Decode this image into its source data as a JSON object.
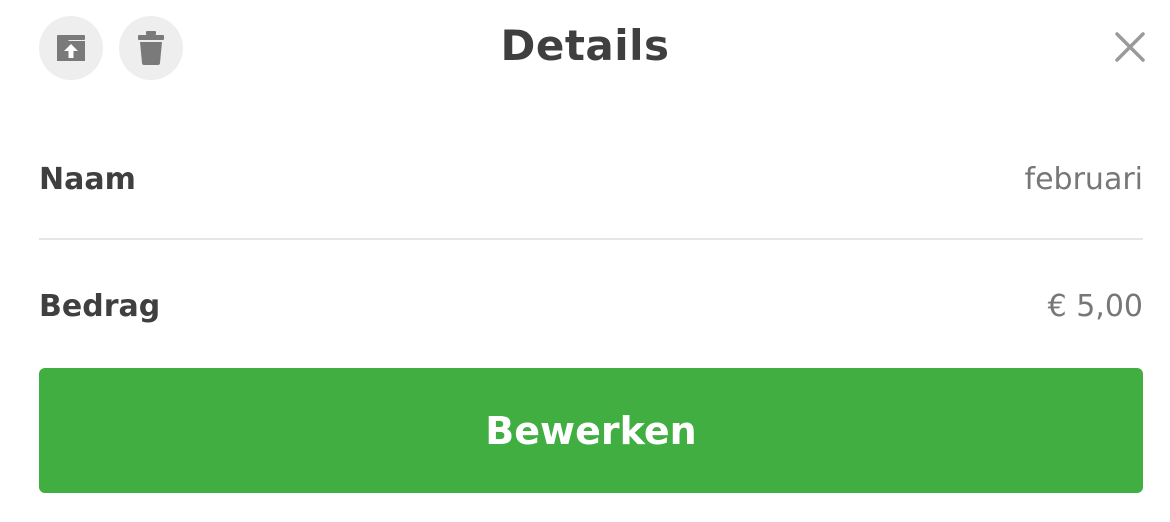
{
  "header": {
    "title": "Details",
    "archive_icon": "archive-upload-icon",
    "delete_icon": "trash-icon",
    "close_icon": "close-icon"
  },
  "fields": [
    {
      "label": "Naam",
      "value": "februari"
    },
    {
      "label": "Bedrag",
      "value": "€ 5,00"
    }
  ],
  "actions": {
    "edit_label": "Bewerken"
  },
  "colors": {
    "accent": "#40ae40",
    "icon": "#7a7a7a",
    "icon_bg": "#eeeeee",
    "text": "#3f3f3f",
    "muted": "#777777"
  }
}
